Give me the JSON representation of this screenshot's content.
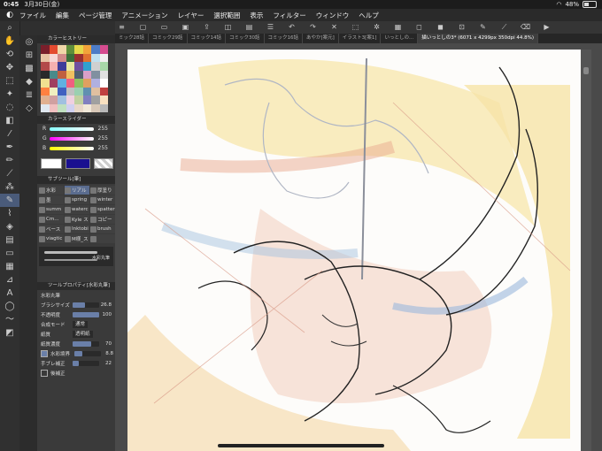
{
  "status": {
    "time": "0:45",
    "date": "3月30日(金)",
    "battery": "48%"
  },
  "menu": {
    "app_icon": "◐",
    "items": [
      "ファイル",
      "編集",
      "ページ管理",
      "アニメーション",
      "レイヤー",
      "選択範囲",
      "表示",
      "フィルター",
      "ウィンドウ",
      "ヘルプ"
    ]
  },
  "doc_tabs": [
    "ミック28話",
    "コミック29話",
    "コミック14話",
    "コミック30話",
    "コミック16話",
    "あやか[案元]",
    "イラスト3[案1]",
    "いっとしの...",
    "描いっとしの3* (6071 x 4299px 350dpi 44.8%)"
  ],
  "color_history": {
    "title": "カラーヒストリー",
    "swatches": [
      "#7a1f2b",
      "#e44a2f",
      "#f0d6a8",
      "#5f8e3a",
      "#e6d84a",
      "#f2a33a",
      "#4d7cc7",
      "#d64c8f",
      "#e8c3a4",
      "#f7d6d6",
      "#d18a8a",
      "#3a6e3a",
      "#9a2f2f",
      "#e07030",
      "#c0e0f0",
      "#f0f0f0",
      "#b34a4a",
      "#f5b0b0",
      "#3d3d9a",
      "#e8e8a0",
      "#7050a0",
      "#30a0d0",
      "#d0d0d0",
      "#a8d8a8",
      "#2a2a2a",
      "#4a8a8a",
      "#c06040",
      "#f0c060",
      "#506070",
      "#d8a0c8",
      "#8090a0",
      "#e0e0e0",
      "#f0e090",
      "#a04060",
      "#60b0e0",
      "#f06080",
      "#90c060",
      "#e0a060",
      "#b0b0e0",
      "#ffffff",
      "#ff8040",
      "#f0f0c0",
      "#4060c0",
      "#c0c0c0",
      "#9ad0b0",
      "#6090b0",
      "#e0c0a0",
      "#c04040",
      "#e0b090",
      "#d0a0a0",
      "#a0c0e0",
      "#f0d0e0",
      "#c0d0a0",
      "#8080c0",
      "#a0a0a0",
      "#f8e0c0",
      "#e0e8f0",
      "#f0c0c0",
      "#c0e0c0",
      "#d0d0f0",
      "#e8d8c8",
      "#f0e8d8",
      "#d8c8b8",
      "#b8b8b8"
    ]
  },
  "color_slider": {
    "title": "カラースライダー",
    "r": {
      "label": "R",
      "value": "255"
    },
    "g": {
      "label": "G",
      "value": "255"
    },
    "b": {
      "label": "B",
      "value": "255"
    }
  },
  "sub_tool": {
    "title": "サブツール[筆]",
    "items": [
      "水彩",
      "リアル",
      "厚塗り",
      "墨",
      "spring",
      "winter",
      "summ",
      "waterc",
      "spatter",
      "Cm...",
      "Kyle ス",
      "コピー",
      "ベース",
      "Inktobi",
      "brush",
      "viagtic",
      "M様_ス",
      ""
    ],
    "active_index": 1
  },
  "brush_preview": {
    "label": "水彩丸筆"
  },
  "tool_property": {
    "title": "ツールプロパティ[水彩丸筆]",
    "tool_name": "水彩丸筆",
    "brush_size": {
      "label": "ブラシサイズ",
      "value": "26.8",
      "fraction": 0.45
    },
    "opacity": {
      "label": "不透明度",
      "value": "100",
      "fraction": 1.0
    },
    "blend_mode": {
      "label": "合成モード",
      "value": "通常"
    },
    "paper": {
      "label": "紙質",
      "value": "透明紙"
    },
    "paper_density": {
      "label": "紙質濃度",
      "value": "70",
      "fraction": 0.7
    },
    "watercolor_edge": {
      "label": "水彩境界",
      "value": "8.8",
      "fraction": 0.3,
      "checked": true
    },
    "stabilization": {
      "label": "手ブレ補正",
      "value": "22",
      "fraction": 0.22
    },
    "post_correction": {
      "label": "後補正",
      "checked": false
    }
  },
  "colors": {
    "panel": "#3a3a3a",
    "accent": "#5a6c8f",
    "main_color": "#ffffff",
    "sub_color": "#1a1090"
  }
}
